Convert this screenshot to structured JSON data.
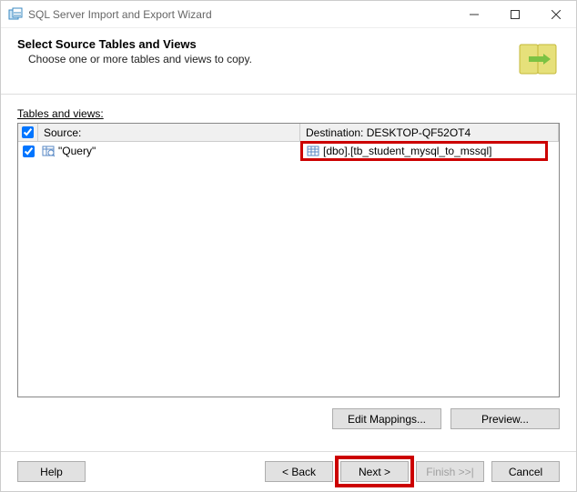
{
  "window": {
    "title": "SQL Server Import and Export Wizard"
  },
  "header": {
    "title": "Select Source Tables and Views",
    "subtitle": "Choose one or more tables and views to copy."
  },
  "content": {
    "tables_label": "Tables and views:",
    "columns": {
      "source": "Source:",
      "destination": "Destination: DESKTOP-QF52OT4"
    },
    "rows": [
      {
        "checked": true,
        "source": "\"Query\"",
        "destination": "[dbo].[tb_student_mysql_to_mssql]"
      }
    ]
  },
  "mid_buttons": {
    "edit_mappings": "Edit Mappings...",
    "preview": "Preview..."
  },
  "footer": {
    "help": "Help",
    "back": "< Back",
    "next": "Next >",
    "finish": "Finish >>|",
    "cancel": "Cancel"
  }
}
